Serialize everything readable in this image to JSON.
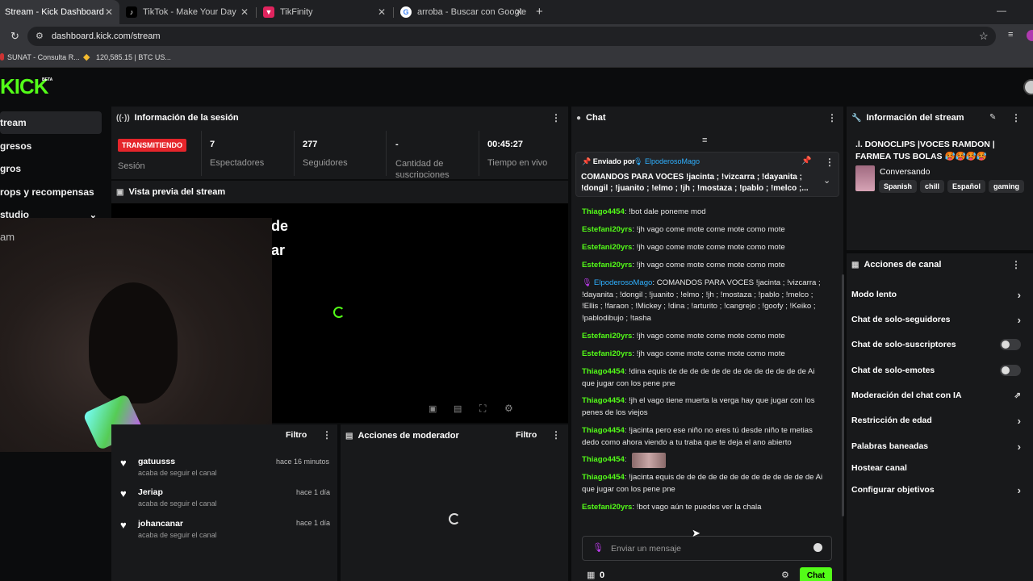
{
  "browser": {
    "tabs": [
      {
        "title": "Stream - Kick Dashboard",
        "icon": "kick-icon"
      },
      {
        "title": "TikTok - Make Your Day",
        "icon": "tiktok-icon"
      },
      {
        "title": "TikFinity",
        "icon": "tikfinity-icon"
      },
      {
        "title": "arroba - Buscar con Google",
        "icon": "google-icon"
      }
    ],
    "url": "dashboard.kick.com/stream",
    "bookmarks": [
      "SUNAT - Consulta R...",
      "120,585.15 | BTC US..."
    ]
  },
  "brand": {
    "logo": "KICK",
    "badge": "BETA",
    "accent": "#53fc18"
  },
  "sidebar": {
    "items": [
      "tream",
      "gresos",
      "gros",
      "rops y recompensas",
      "studio"
    ],
    "overlay_text": "am"
  },
  "session": {
    "title": "Información de la sesión",
    "status_badge": "TRANSMITIENDO",
    "status_label": "Sesión",
    "stats": [
      {
        "value": "7",
        "label": "Espectadores"
      },
      {
        "value": "277",
        "label": "Seguidores"
      },
      {
        "value": "-",
        "label": "Cantidad de suscripciones"
      },
      {
        "value": "00:45:27",
        "label": "Tiempo en vivo"
      }
    ]
  },
  "preview": {
    "title": "Vista previa del stream",
    "overlay_lines": [
      "de",
      "ar"
    ]
  },
  "activity": {
    "filter": "Filtro",
    "items": [
      {
        "name": "gatuusss",
        "desc": "acaba de seguir el canal",
        "time": "hace 16 minutos"
      },
      {
        "name": "Jeriap",
        "desc": "acaba de seguir el canal",
        "time": "hace 1 día"
      },
      {
        "name": "johancanar",
        "desc": "acaba de seguir el canal",
        "time": "hace 1 día"
      }
    ]
  },
  "moderator": {
    "title": "Acciones de moderador",
    "filter": "Filtro"
  },
  "chat": {
    "title": "Chat",
    "pinned": {
      "label": "Enviado por",
      "user": "ElpoderosoMago",
      "text": "COMANDOS PARA VOCES !jacinta ; !vizcarra ; !dayanita ; !dongil ; !juanito ; !elmo ; !jh ; !mostaza ; !pablo ; !melco ;..."
    },
    "messages": [
      {
        "user": "Thiago4454",
        "text": "!bot dale poneme mod"
      },
      {
        "user": "Estefani20yrs",
        "text": "!jh vago come mote come mote como mote"
      },
      {
        "user": "Estefani20yrs",
        "text": "!jh vago come mote come mote como mote"
      },
      {
        "user": "Estefani20yrs",
        "text": "!jh vago come mote come mote como mote"
      },
      {
        "user": "ElpoderosoMago",
        "text": "COMANDOS PARA VOCES !jacinta ; !vizcarra ; !dayanita ; !dongil ; !juanito ; !elmo ; !jh ; !mostaza ; !pablo ; !melco ; !Ellis ; !faraon ; !Mickey ; !dina ; !arturito ; !cangrejo ; !goofy ; !Keiko ; !pablodibujo ; !tasha",
        "mod": true
      },
      {
        "user": "Estefani20yrs",
        "text": "!jh vago come mote come mote como mote"
      },
      {
        "user": "Estefani20yrs",
        "text": "!jh vago come mote come mote como mote"
      },
      {
        "user": "Thiago4454",
        "text": "!dina equis de de de de de de de de de de de de de Ai que jugar con los pene pne"
      },
      {
        "user": "Thiago4454",
        "text": "!jh el vago tiene muerta la verga hay que jugar con los penes de los viejos"
      },
      {
        "user": "Thiago4454",
        "text": "!jacinta pero ese niño no eres tú desde niño te metias dedo como ahora viendo a tu traba que te deja el ano abierto"
      },
      {
        "user": "Thiago4454",
        "text": ""
      },
      {
        "user": "Thiago4454",
        "text": "!jacinta equis de de de de de de de de de de de de de Ai que jugar con los pene pne"
      },
      {
        "user": "Estefani20yrs",
        "text": "!bot vago aún te puedes ver la chala"
      }
    ],
    "input_placeholder": "Enviar un mensaje",
    "points": "0",
    "send_label": "Chat"
  },
  "stream_info": {
    "title": "Información del stream",
    "stream_title": ".l. DONOCLIPS |VOCES RAMDON | FARMEA TUS BOLAS 🥵🥵🥵🥵",
    "category": "Conversando",
    "tags": [
      "Spanish",
      "chill",
      "Español",
      "gaming"
    ]
  },
  "channel_actions": {
    "title": "Acciones de canal",
    "items": [
      {
        "label": "Modo lento",
        "kind": "chevron"
      },
      {
        "label": "Chat de solo-seguidores",
        "kind": "chevron"
      },
      {
        "label": "Chat de solo-suscriptores",
        "kind": "toggle"
      },
      {
        "label": "Chat de solo-emotes",
        "kind": "toggle"
      },
      {
        "label": "Moderación del chat con IA",
        "kind": "external"
      },
      {
        "label": "Restricción de edad",
        "kind": "chevron"
      },
      {
        "label": "Palabras baneadas",
        "kind": "chevron"
      },
      {
        "label": "Hostear canal",
        "kind": "none"
      },
      {
        "label": "Configurar objetivos",
        "kind": "chevron"
      }
    ]
  }
}
